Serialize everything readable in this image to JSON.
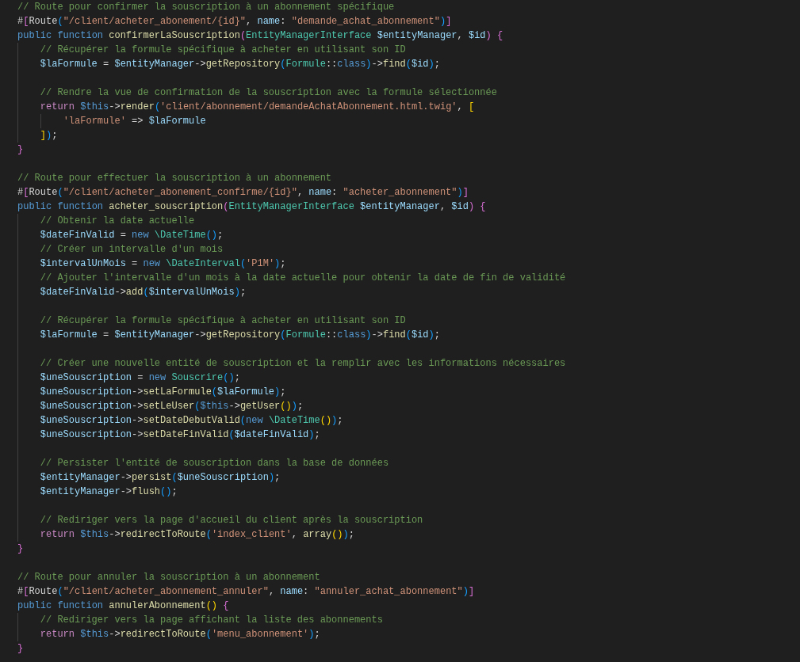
{
  "editor": {
    "blocks": [
      {
        "lines": [
          {
            "tokens": [
              {
                "kind": "comment",
                "text": "// Route pour confirmer la souscription à un abonnement spécifique"
              }
            ]
          },
          {
            "tokens": [
              {
                "kind": "plain",
                "text": "#"
              },
              {
                "kind": "bracket2",
                "text": "["
              },
              {
                "kind": "plain",
                "text": "Route"
              },
              {
                "kind": "bracket3",
                "text": "("
              },
              {
                "kind": "string",
                "text": "\"/client/acheter_abonement/{id}\""
              },
              {
                "kind": "plain",
                "text": ", "
              },
              {
                "kind": "variable",
                "text": "name"
              },
              {
                "kind": "plain",
                "text": ": "
              },
              {
                "kind": "string",
                "text": "\"demande_achat_abonnement\""
              },
              {
                "kind": "bracket3",
                "text": ")"
              },
              {
                "kind": "bracket2",
                "text": "]"
              }
            ]
          },
          {
            "tokens": [
              {
                "kind": "keyword",
                "text": "public "
              },
              {
                "kind": "keyword",
                "text": "function "
              },
              {
                "kind": "function",
                "text": "confirmerLaSouscription"
              },
              {
                "kind": "bracket2",
                "text": "("
              },
              {
                "kind": "type",
                "text": "EntityManagerInterface "
              },
              {
                "kind": "variable",
                "text": "$entityManager"
              },
              {
                "kind": "plain",
                "text": ", "
              },
              {
                "kind": "variable",
                "text": "$id"
              },
              {
                "kind": "bracket2",
                "text": ") {"
              }
            ]
          },
          {
            "tokens": [
              {
                "kind": "comment",
                "text": "    // Récupérer la formule spécifique à acheter en utilisant son ID"
              }
            ]
          },
          {
            "tokens": [
              {
                "kind": "variable",
                "text": "    $laFormule"
              },
              {
                "kind": "plain",
                "text": " = "
              },
              {
                "kind": "variable",
                "text": "$entityManager"
              },
              {
                "kind": "plain",
                "text": "->"
              },
              {
                "kind": "function",
                "text": "getRepository"
              },
              {
                "kind": "bracket3",
                "text": "("
              },
              {
                "kind": "type",
                "text": "Formule"
              },
              {
                "kind": "plain",
                "text": "::"
              },
              {
                "kind": "keyword",
                "text": "class"
              },
              {
                "kind": "bracket3",
                "text": ")"
              },
              {
                "kind": "plain",
                "text": "->"
              },
              {
                "kind": "function",
                "text": "find"
              },
              {
                "kind": "bracket3",
                "text": "("
              },
              {
                "kind": "variable",
                "text": "$id"
              },
              {
                "kind": "bracket3",
                "text": ")"
              },
              {
                "kind": "plain",
                "text": ";"
              }
            ]
          }
        ]
      },
      {
        "lines": [
          {
            "tokens": [
              {
                "kind": "comment",
                "text": "    // Rendre la vue de confirmation de la souscription avec la formule sélectionnée"
              }
            ]
          },
          {
            "tokens": [
              {
                "kind": "control",
                "text": "    return "
              },
              {
                "kind": "keyword",
                "text": "$this"
              },
              {
                "kind": "plain",
                "text": "->"
              },
              {
                "kind": "function",
                "text": "render"
              },
              {
                "kind": "bracket3",
                "text": "("
              },
              {
                "kind": "string",
                "text": "'client/abonnement/demandeAchatAbonnement.html.twig'"
              },
              {
                "kind": "plain",
                "text": ", "
              },
              {
                "kind": "bracket1",
                "text": "["
              }
            ]
          },
          {
            "tokens": [
              {
                "kind": "string",
                "text": "        'laFormule'"
              },
              {
                "kind": "plain",
                "text": " => "
              },
              {
                "kind": "variable",
                "text": "$laFormule"
              }
            ]
          },
          {
            "tokens": [
              {
                "kind": "bracket1",
                "text": "    ]"
              },
              {
                "kind": "bracket3",
                "text": ")"
              },
              {
                "kind": "plain",
                "text": ";"
              }
            ]
          },
          {
            "tokens": [
              {
                "kind": "bracket2",
                "text": "}"
              }
            ]
          }
        ]
      },
      {
        "lines": [
          {
            "tokens": [
              {
                "kind": "comment",
                "text": "// Route pour effectuer la souscription à un abonnement"
              }
            ]
          },
          {
            "tokens": [
              {
                "kind": "plain",
                "text": "#"
              },
              {
                "kind": "bracket2",
                "text": "["
              },
              {
                "kind": "plain",
                "text": "Route"
              },
              {
                "kind": "bracket3",
                "text": "("
              },
              {
                "kind": "string",
                "text": "\"/client/acheter_abonement_confirme/{id}\""
              },
              {
                "kind": "plain",
                "text": ", "
              },
              {
                "kind": "variable",
                "text": "name"
              },
              {
                "kind": "plain",
                "text": ": "
              },
              {
                "kind": "string",
                "text": "\"acheter_abonnement\""
              },
              {
                "kind": "bracket3",
                "text": ")"
              },
              {
                "kind": "bracket2",
                "text": "]"
              }
            ]
          },
          {
            "tokens": [
              {
                "kind": "keyword",
                "text": "public "
              },
              {
                "kind": "keyword",
                "text": "function "
              },
              {
                "kind": "function",
                "text": "acheter_souscription"
              },
              {
                "kind": "bracket2",
                "text": "("
              },
              {
                "kind": "type",
                "text": "EntityManagerInterface "
              },
              {
                "kind": "variable",
                "text": "$entityManager"
              },
              {
                "kind": "plain",
                "text": ", "
              },
              {
                "kind": "variable",
                "text": "$id"
              },
              {
                "kind": "bracket2",
                "text": ") {"
              }
            ]
          },
          {
            "tokens": [
              {
                "kind": "comment",
                "text": "    // Obtenir la date actuelle"
              }
            ]
          },
          {
            "tokens": [
              {
                "kind": "variable",
                "text": "    $dateFinValid"
              },
              {
                "kind": "plain",
                "text": " = "
              },
              {
                "kind": "keyword",
                "text": "new "
              },
              {
                "kind": "type",
                "text": "\\DateTime"
              },
              {
                "kind": "bracket3",
                "text": "()"
              },
              {
                "kind": "plain",
                "text": ";"
              }
            ]
          },
          {
            "tokens": [
              {
                "kind": "comment",
                "text": "    // Créer un intervalle d'un mois"
              }
            ]
          },
          {
            "tokens": [
              {
                "kind": "variable",
                "text": "    $intervalUnMois"
              },
              {
                "kind": "plain",
                "text": " = "
              },
              {
                "kind": "keyword",
                "text": "new "
              },
              {
                "kind": "type",
                "text": "\\DateInterval"
              },
              {
                "kind": "bracket3",
                "text": "("
              },
              {
                "kind": "string",
                "text": "'P1M'"
              },
              {
                "kind": "bracket3",
                "text": ")"
              },
              {
                "kind": "plain",
                "text": ";"
              }
            ]
          },
          {
            "tokens": [
              {
                "kind": "comment",
                "text": "    // Ajouter l'intervalle d'un mois à la date actuelle pour obtenir la date de fin de validité"
              }
            ]
          },
          {
            "tokens": [
              {
                "kind": "variable",
                "text": "    $dateFinValid"
              },
              {
                "kind": "plain",
                "text": "->"
              },
              {
                "kind": "function",
                "text": "add"
              },
              {
                "kind": "bracket3",
                "text": "("
              },
              {
                "kind": "variable",
                "text": "$intervalUnMois"
              },
              {
                "kind": "bracket3",
                "text": ")"
              },
              {
                "kind": "plain",
                "text": ";"
              }
            ]
          }
        ]
      },
      {
        "lines": [
          {
            "tokens": [
              {
                "kind": "comment",
                "text": "    // Récupérer la formule spécifique à acheter en utilisant son ID"
              }
            ]
          },
          {
            "tokens": [
              {
                "kind": "variable",
                "text": "    $laFormule"
              },
              {
                "kind": "plain",
                "text": " = "
              },
              {
                "kind": "variable",
                "text": "$entityManager"
              },
              {
                "kind": "plain",
                "text": "->"
              },
              {
                "kind": "function",
                "text": "getRepository"
              },
              {
                "kind": "bracket3",
                "text": "("
              },
              {
                "kind": "type",
                "text": "Formule"
              },
              {
                "kind": "plain",
                "text": "::"
              },
              {
                "kind": "keyword",
                "text": "class"
              },
              {
                "kind": "bracket3",
                "text": ")"
              },
              {
                "kind": "plain",
                "text": "->"
              },
              {
                "kind": "function",
                "text": "find"
              },
              {
                "kind": "bracket3",
                "text": "("
              },
              {
                "kind": "variable",
                "text": "$id"
              },
              {
                "kind": "bracket3",
                "text": ")"
              },
              {
                "kind": "plain",
                "text": ";"
              }
            ]
          }
        ]
      },
      {
        "lines": [
          {
            "tokens": [
              {
                "kind": "comment",
                "text": "    // Créer une nouvelle entité de souscription et la remplir avec les informations nécessaires"
              }
            ]
          },
          {
            "tokens": [
              {
                "kind": "variable",
                "text": "    $uneSouscription"
              },
              {
                "kind": "plain",
                "text": " = "
              },
              {
                "kind": "keyword",
                "text": "new "
              },
              {
                "kind": "type",
                "text": "Souscrire"
              },
              {
                "kind": "bracket3",
                "text": "()"
              },
              {
                "kind": "plain",
                "text": ";"
              }
            ]
          },
          {
            "tokens": [
              {
                "kind": "variable",
                "text": "    $uneSouscription"
              },
              {
                "kind": "plain",
                "text": "->"
              },
              {
                "kind": "function",
                "text": "setLaFormule"
              },
              {
                "kind": "bracket3",
                "text": "("
              },
              {
                "kind": "variable",
                "text": "$laFormule"
              },
              {
                "kind": "bracket3",
                "text": ")"
              },
              {
                "kind": "plain",
                "text": ";"
              }
            ]
          },
          {
            "tokens": [
              {
                "kind": "variable",
                "text": "    $uneSouscription"
              },
              {
                "kind": "plain",
                "text": "->"
              },
              {
                "kind": "function",
                "text": "setLeUser"
              },
              {
                "kind": "bracket3",
                "text": "("
              },
              {
                "kind": "keyword",
                "text": "$this"
              },
              {
                "kind": "plain",
                "text": "->"
              },
              {
                "kind": "function",
                "text": "getUser"
              },
              {
                "kind": "bracket1",
                "text": "()"
              },
              {
                "kind": "bracket3",
                "text": ")"
              },
              {
                "kind": "plain",
                "text": ";"
              }
            ]
          },
          {
            "tokens": [
              {
                "kind": "variable",
                "text": "    $uneSouscription"
              },
              {
                "kind": "plain",
                "text": "->"
              },
              {
                "kind": "function",
                "text": "setDateDebutValid"
              },
              {
                "kind": "bracket3",
                "text": "("
              },
              {
                "kind": "keyword",
                "text": "new "
              },
              {
                "kind": "type",
                "text": "\\DateTime"
              },
              {
                "kind": "bracket1",
                "text": "()"
              },
              {
                "kind": "bracket3",
                "text": ")"
              },
              {
                "kind": "plain",
                "text": ";"
              }
            ]
          },
          {
            "tokens": [
              {
                "kind": "variable",
                "text": "    $uneSouscription"
              },
              {
                "kind": "plain",
                "text": "->"
              },
              {
                "kind": "function",
                "text": "setDateFinValid"
              },
              {
                "kind": "bracket3",
                "text": "("
              },
              {
                "kind": "variable",
                "text": "$dateFinValid"
              },
              {
                "kind": "bracket3",
                "text": ")"
              },
              {
                "kind": "plain",
                "text": ";"
              }
            ]
          }
        ]
      },
      {
        "lines": [
          {
            "tokens": [
              {
                "kind": "comment",
                "text": "    // Persister l'entité de souscription dans la base de données"
              }
            ]
          },
          {
            "tokens": [
              {
                "kind": "variable",
                "text": "    $entityManager"
              },
              {
                "kind": "plain",
                "text": "->"
              },
              {
                "kind": "function",
                "text": "persist"
              },
              {
                "kind": "bracket3",
                "text": "("
              },
              {
                "kind": "variable",
                "text": "$uneSouscription"
              },
              {
                "kind": "bracket3",
                "text": ")"
              },
              {
                "kind": "plain",
                "text": ";"
              }
            ]
          },
          {
            "tokens": [
              {
                "kind": "variable",
                "text": "    $entityManager"
              },
              {
                "kind": "plain",
                "text": "->"
              },
              {
                "kind": "function",
                "text": "flush"
              },
              {
                "kind": "bracket3",
                "text": "()"
              },
              {
                "kind": "plain",
                "text": ";"
              }
            ]
          }
        ]
      },
      {
        "lines": [
          {
            "tokens": [
              {
                "kind": "comment",
                "text": "    // Rediriger vers la page d'accueil du client après la souscription"
              }
            ]
          },
          {
            "tokens": [
              {
                "kind": "control",
                "text": "    return "
              },
              {
                "kind": "keyword",
                "text": "$this"
              },
              {
                "kind": "plain",
                "text": "->"
              },
              {
                "kind": "function",
                "text": "redirectToRoute"
              },
              {
                "kind": "bracket3",
                "text": "("
              },
              {
                "kind": "string",
                "text": "'index_client'"
              },
              {
                "kind": "plain",
                "text": ", "
              },
              {
                "kind": "function",
                "text": "array"
              },
              {
                "kind": "bracket1",
                "text": "()"
              },
              {
                "kind": "bracket3",
                "text": ")"
              },
              {
                "kind": "plain",
                "text": ";"
              }
            ]
          },
          {
            "tokens": [
              {
                "kind": "bracket2",
                "text": "}"
              }
            ]
          }
        ]
      },
      {
        "lines": [
          {
            "tokens": [
              {
                "kind": "comment",
                "text": "// Route pour annuler la souscription à un abonnement"
              }
            ]
          },
          {
            "tokens": [
              {
                "kind": "plain",
                "text": "#"
              },
              {
                "kind": "bracket2",
                "text": "["
              },
              {
                "kind": "plain",
                "text": "Route"
              },
              {
                "kind": "bracket3",
                "text": "("
              },
              {
                "kind": "string",
                "text": "\"/client/acheter_abonnement_annuler\""
              },
              {
                "kind": "plain",
                "text": ", "
              },
              {
                "kind": "variable",
                "text": "name"
              },
              {
                "kind": "plain",
                "text": ": "
              },
              {
                "kind": "string",
                "text": "\"annuler_achat_abonnement\""
              },
              {
                "kind": "bracket3",
                "text": ")"
              },
              {
                "kind": "bracket2",
                "text": "]"
              }
            ]
          },
          {
            "tokens": [
              {
                "kind": "keyword",
                "text": "public "
              },
              {
                "kind": "keyword",
                "text": "function "
              },
              {
                "kind": "function",
                "text": "annulerAbonnement"
              },
              {
                "kind": "bracket1",
                "text": "()"
              },
              {
                "kind": "bracket2",
                "text": " {"
              }
            ]
          },
          {
            "tokens": [
              {
                "kind": "comment",
                "text": "    // Rediriger vers la page affichant la liste des abonnements"
              }
            ]
          },
          {
            "tokens": [
              {
                "kind": "control",
                "text": "    return "
              },
              {
                "kind": "keyword",
                "text": "$this"
              },
              {
                "kind": "plain",
                "text": "->"
              },
              {
                "kind": "function",
                "text": "redirectToRoute"
              },
              {
                "kind": "bracket3",
                "text": "("
              },
              {
                "kind": "string",
                "text": "'menu_abonnement'"
              },
              {
                "kind": "bracket3",
                "text": ")"
              },
              {
                "kind": "plain",
                "text": ";"
              }
            ]
          },
          {
            "tokens": [
              {
                "kind": "bracket2",
                "text": "}"
              }
            ]
          }
        ]
      }
    ]
  }
}
